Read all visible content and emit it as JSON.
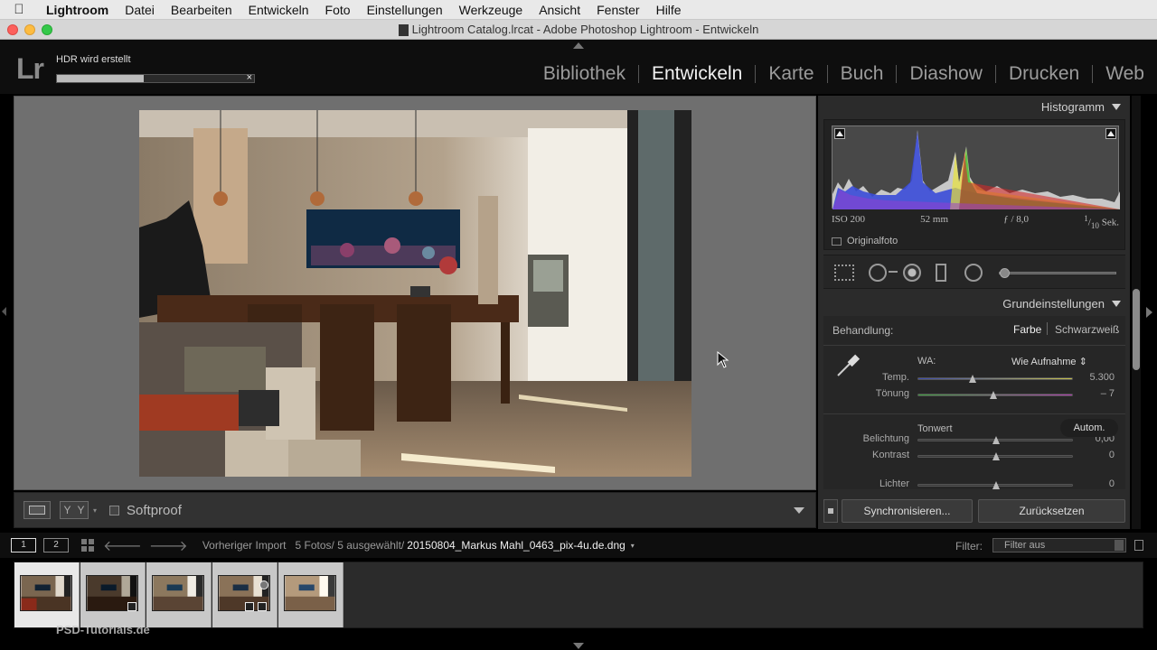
{
  "menubar": {
    "apple": "",
    "items": [
      "Lightroom",
      "Datei",
      "Bearbeiten",
      "Entwickeln",
      "Foto",
      "Einstellungen",
      "Werkzeuge",
      "Ansicht",
      "Fenster",
      "Hilfe"
    ]
  },
  "window": {
    "title": "Lightroom Catalog.lrcat - Adobe Photoshop Lightroom - Entwickeln"
  },
  "identity": {
    "logo": "Lr",
    "status_text": "HDR wird erstellt",
    "progress_fraction": 0.44,
    "progress_close": "×"
  },
  "modules": {
    "items": [
      "Bibliothek",
      "Entwickeln",
      "Karte",
      "Buch",
      "Diashow",
      "Drucken",
      "Web"
    ],
    "active": "Entwickeln"
  },
  "toolbar": {
    "yy_left": "Y",
    "yy_right": "Y",
    "yy_arrow": "▾",
    "softproof_label": "Softproof"
  },
  "histogram": {
    "header": "Histogramm",
    "iso": "ISO 200",
    "focal": "52 mm",
    "aperture": "ƒ / 8,0",
    "shutter_num": "1",
    "shutter_den": "10",
    "shutter_unit": "Sek.",
    "original_label": "Originalfoto"
  },
  "basic": {
    "header": "Grundeinstellungen",
    "treatment_label": "Behandlung:",
    "treatment_color": "Farbe",
    "treatment_bw": "Schwarzweiß",
    "wa_label": "WA:",
    "wa_value": "Wie Aufnahme",
    "wa_arrows": "⇕",
    "tone_label": "Tonwert",
    "auto_label": "Autom.",
    "sliders": [
      {
        "label": "Temp.",
        "value": "5.300",
        "pos": 0.35
      },
      {
        "label": "Tönung",
        "value": "– 7",
        "pos": 0.48
      },
      {
        "label": "Belichtung",
        "value": "0,00",
        "pos": 0.5
      },
      {
        "label": "Kontrast",
        "value": "0",
        "pos": 0.5
      },
      {
        "label": "Lichter",
        "value": "0",
        "pos": 0.5
      }
    ]
  },
  "actions": {
    "sync": "Synchronisieren...",
    "reset": "Zurücksetzen"
  },
  "filmnav": {
    "monitor1": "1",
    "monitor2": "2",
    "source": "Vorheriger Import",
    "count": "5 Fotos/ 5 ausgewählt/",
    "filename": "20150804_Markus Mahl_0463_pix-4u.de.dng",
    "file_arrow": "▾",
    "filter_label": "Filter:",
    "filter_value": "Filter aus"
  },
  "watermark": "PSD-Tutorials.de",
  "colors": {
    "accent": "#f0f0f0",
    "panel": "#2b2b2b",
    "center_bg": "#6f6f6f"
  }
}
